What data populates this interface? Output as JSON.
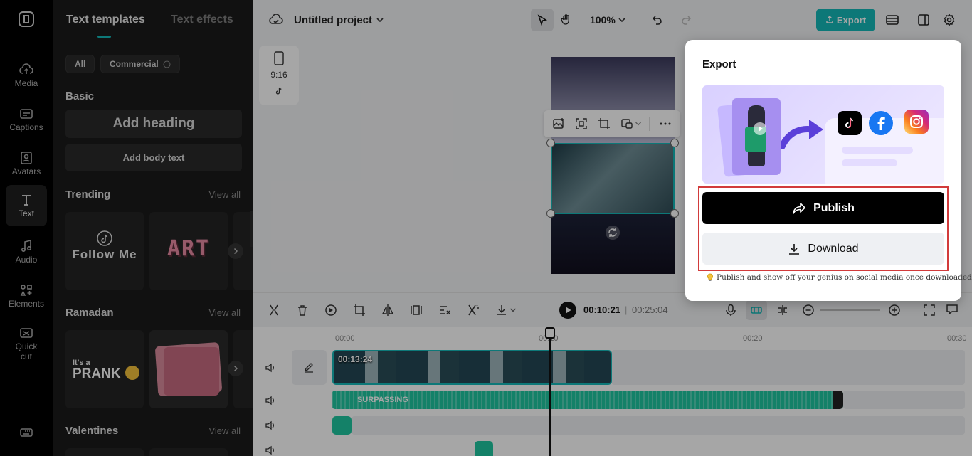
{
  "rail": {
    "items": [
      {
        "label": "Media",
        "icon": "cloud-upload-icon"
      },
      {
        "label": "Captions",
        "icon": "captions-icon"
      },
      {
        "label": "Avatars",
        "icon": "avatar-icon"
      },
      {
        "label": "Text",
        "icon": "text-icon"
      },
      {
        "label": "Audio",
        "icon": "music-note-icon"
      },
      {
        "label": "Elements",
        "icon": "elements-icon"
      },
      {
        "label": "Quick cut",
        "icon": "quick-cut-icon"
      }
    ],
    "active": "Text"
  },
  "panel": {
    "tabs": [
      "Text templates",
      "Text effects"
    ],
    "filters": [
      "All",
      "Commercial"
    ],
    "basic_title": "Basic",
    "add_heading": "Add heading",
    "add_body": "Add body text",
    "sections": [
      {
        "title": "Trending",
        "view_all": "View all"
      },
      {
        "title": "Ramadan",
        "view_all": "View all"
      },
      {
        "title": "Valentines",
        "view_all": "View all"
      }
    ],
    "card_texts": {
      "follow_me": "Follow Me",
      "art": "ART",
      "its_a": "It's a",
      "prank": "PRANK"
    }
  },
  "topbar": {
    "project_title": "Untitled project",
    "zoom": "100%",
    "export_label": "Export"
  },
  "canvas": {
    "ratio": "9:16"
  },
  "timeline": {
    "current_time": "00:10:21",
    "separator": "|",
    "total_time": "00:25:04",
    "ruler": [
      "00:00",
      "00:10",
      "00:20",
      "00:30"
    ],
    "video_clip_duration": "00:13:24",
    "audio_clip_label": "SURPASSING"
  },
  "export_popup": {
    "title": "Export",
    "publish_label": "Publish",
    "download_label": "Download",
    "note": "Publish and show off your genius on social media once downloaded."
  },
  "colors": {
    "accent": "#14b8b8",
    "highlight": "#d23b3b",
    "audio": "#1fc7a0"
  }
}
